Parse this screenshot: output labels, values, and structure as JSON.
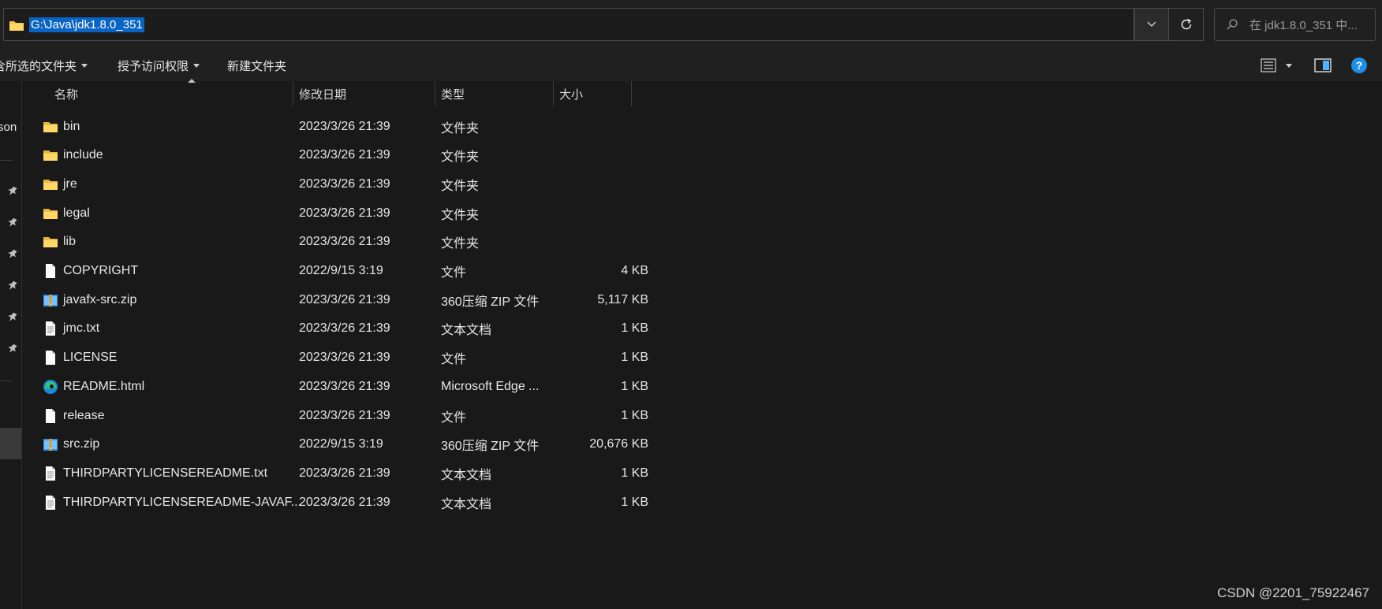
{
  "address_bar": {
    "path": "G:\\Java\\jdk1.8.0_351",
    "search_placeholder": "在 jdk1.8.0_351 中..."
  },
  "toolbar": {
    "include_label": "含所选的文件夹",
    "grant_access_label": "授予访问权限",
    "new_folder_label": "新建文件夹"
  },
  "nav": {
    "partial_label": "rson"
  },
  "columns": {
    "name": "名称",
    "date": "修改日期",
    "type": "类型",
    "size": "大小"
  },
  "files": [
    {
      "name": "bin",
      "date": "2023/3/26 21:39",
      "type": "文件夹",
      "size": "",
      "icon": "folder-icon"
    },
    {
      "name": "include",
      "date": "2023/3/26 21:39",
      "type": "文件夹",
      "size": "",
      "icon": "folder-icon"
    },
    {
      "name": "jre",
      "date": "2023/3/26 21:39",
      "type": "文件夹",
      "size": "",
      "icon": "folder-icon"
    },
    {
      "name": "legal",
      "date": "2023/3/26 21:39",
      "type": "文件夹",
      "size": "",
      "icon": "folder-icon"
    },
    {
      "name": "lib",
      "date": "2023/3/26 21:39",
      "type": "文件夹",
      "size": "",
      "icon": "folder-icon"
    },
    {
      "name": "COPYRIGHT",
      "date": "2022/9/15 3:19",
      "type": "文件",
      "size": "4 KB",
      "icon": "file-icon"
    },
    {
      "name": "javafx-src.zip",
      "date": "2023/3/26 21:39",
      "type": "360压缩 ZIP 文件",
      "size": "5,117 KB",
      "icon": "zip-icon"
    },
    {
      "name": "jmc.txt",
      "date": "2023/3/26 21:39",
      "type": "文本文档",
      "size": "1 KB",
      "icon": "text-file-icon"
    },
    {
      "name": "LICENSE",
      "date": "2023/3/26 21:39",
      "type": "文件",
      "size": "1 KB",
      "icon": "file-icon"
    },
    {
      "name": "README.html",
      "date": "2023/3/26 21:39",
      "type": "Microsoft Edge ...",
      "size": "1 KB",
      "icon": "edge-icon"
    },
    {
      "name": "release",
      "date": "2023/3/26 21:39",
      "type": "文件",
      "size": "1 KB",
      "icon": "file-icon"
    },
    {
      "name": "src.zip",
      "date": "2022/9/15 3:19",
      "type": "360压缩 ZIP 文件",
      "size": "20,676 KB",
      "icon": "zip-icon"
    },
    {
      "name": "THIRDPARTYLICENSEREADME.txt",
      "date": "2023/3/26 21:39",
      "type": "文本文档",
      "size": "1 KB",
      "icon": "text-file-icon"
    },
    {
      "name": "THIRDPARTYLICENSEREADME-JAVAF...",
      "date": "2023/3/26 21:39",
      "type": "文本文档",
      "size": "1 KB",
      "icon": "text-file-icon"
    }
  ],
  "watermark": "CSDN @2201_75922467",
  "colors": {
    "background": "#191919",
    "selection": "#0a64c4",
    "folder": "#f7c64a",
    "help": "#1e8fe6"
  }
}
